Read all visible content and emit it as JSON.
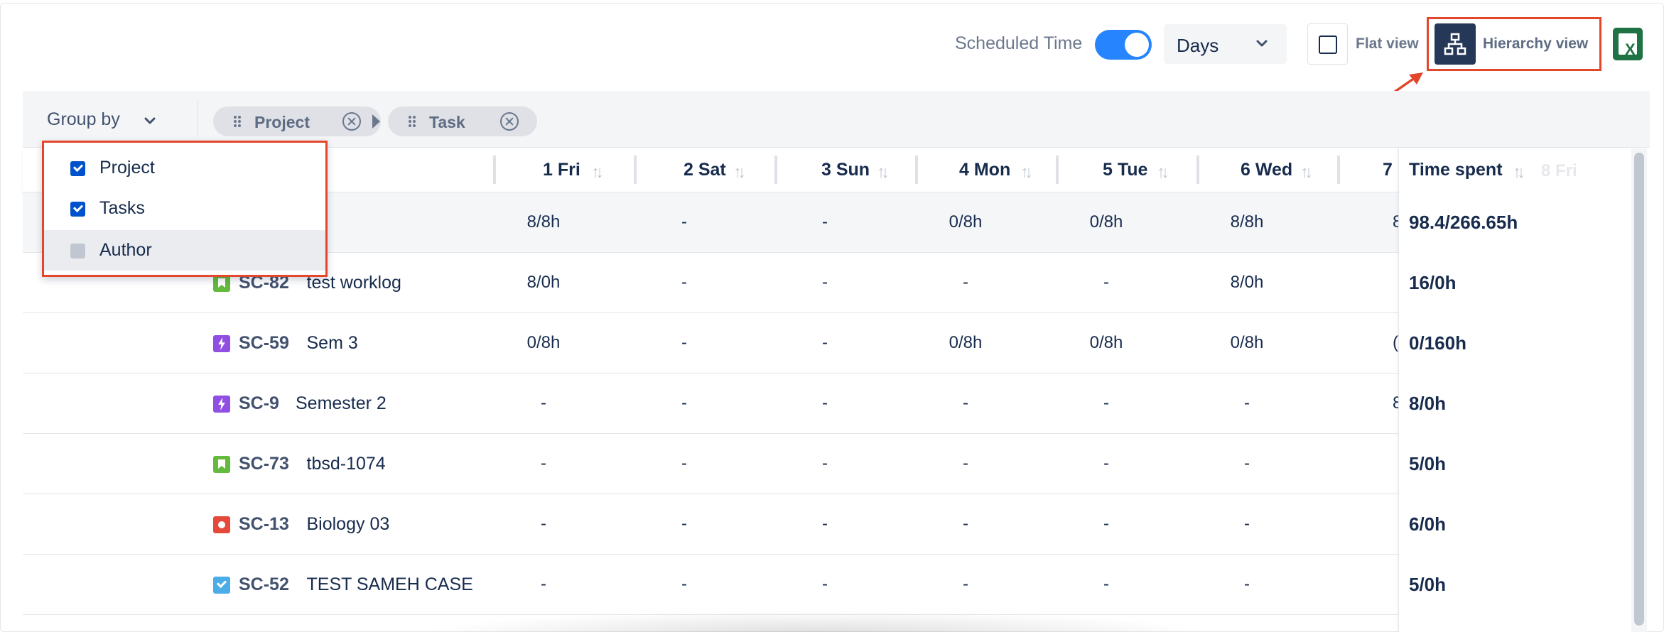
{
  "toolbar": {
    "scheduled_time_label": "Scheduled Time",
    "scheduled_time_on": true,
    "period_select": "Days",
    "flat_view_label": "Flat view",
    "hierarchy_view_label": "Hierarchy view",
    "excel_icon": "excel-icon",
    "accent_color": "#e2472b",
    "toggle_color": "#2684ff"
  },
  "group_bar": {
    "group_by_label": "Group by",
    "chips": [
      {
        "label": "Project"
      },
      {
        "label": "Task"
      }
    ]
  },
  "group_by_menu": {
    "options": [
      {
        "label": "Project",
        "checked": true
      },
      {
        "label": "Tasks",
        "checked": true
      },
      {
        "label": "Author",
        "checked": false
      }
    ]
  },
  "table": {
    "columns": [
      "1 Fri",
      "2 Sat",
      "3 Sun",
      "4 Mon",
      "5 Tue",
      "6 Wed",
      "7"
    ],
    "time_spent_header": "Time spent",
    "ghost_header": "8 Fri",
    "total_row": {
      "values": [
        "8/8h",
        "-",
        "-",
        "0/8h",
        "0/8h",
        "8/8h",
        "8"
      ],
      "time_spent": "98.4/266.65h"
    },
    "rows": [
      {
        "type": "story",
        "key": "SC-82",
        "summary": "test worklog",
        "values": [
          "8/0h",
          "-",
          "-",
          "-",
          "-",
          "8/0h",
          ""
        ],
        "time_spent": "16/0h"
      },
      {
        "type": "epic",
        "key": "SC-59",
        "summary": "Sem 3",
        "values": [
          "0/8h",
          "-",
          "-",
          "0/8h",
          "0/8h",
          "0/8h",
          "("
        ],
        "time_spent": "0/160h"
      },
      {
        "type": "epic",
        "key": "SC-9",
        "summary": "Semester 2",
        "values": [
          "-",
          "-",
          "-",
          "-",
          "-",
          "-",
          "8"
        ],
        "time_spent": "8/0h"
      },
      {
        "type": "story",
        "key": "SC-73",
        "summary": "tbsd-1074",
        "values": [
          "-",
          "-",
          "-",
          "-",
          "-",
          "-",
          ""
        ],
        "time_spent": "5/0h"
      },
      {
        "type": "bug",
        "key": "SC-13",
        "summary": "Biology 03",
        "values": [
          "-",
          "-",
          "-",
          "-",
          "-",
          "-",
          ""
        ],
        "time_spent": "6/0h"
      },
      {
        "type": "task",
        "key": "SC-52",
        "summary": "TEST SAMEH CASE",
        "values": [
          "-",
          "-",
          "-",
          "-",
          "-",
          "-",
          ""
        ],
        "time_spent": "5/0h"
      }
    ]
  }
}
